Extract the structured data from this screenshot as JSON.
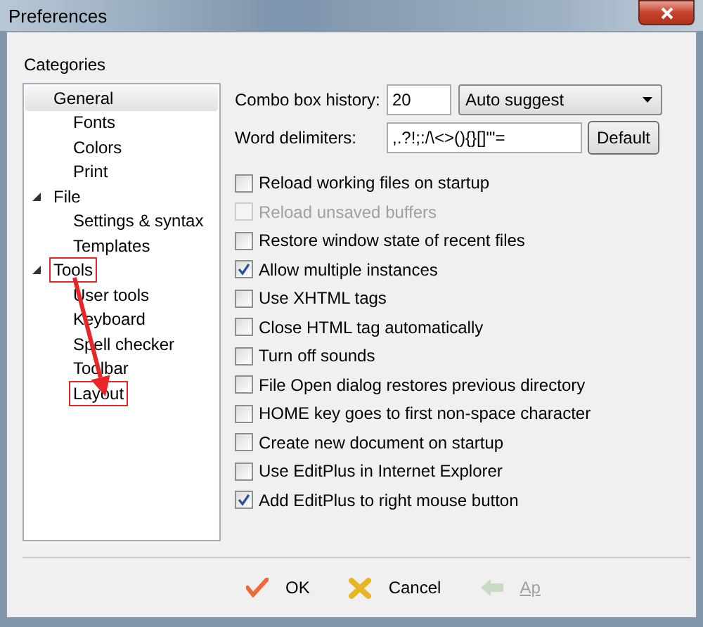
{
  "window": {
    "title": "Preferences"
  },
  "categories": {
    "label": "Categories",
    "items": [
      {
        "label": "General",
        "selected": true,
        "highlighted": false,
        "children": [
          {
            "label": "Fonts",
            "selected": false,
            "highlighted": false
          },
          {
            "label": "Colors",
            "selected": false,
            "highlighted": false
          },
          {
            "label": "Print",
            "selected": false,
            "highlighted": false
          }
        ]
      },
      {
        "label": "File",
        "selected": false,
        "highlighted": false,
        "expanded": true,
        "children": [
          {
            "label": "Settings & syntax",
            "selected": false,
            "highlighted": false
          },
          {
            "label": "Templates",
            "selected": false,
            "highlighted": false
          }
        ]
      },
      {
        "label": "Tools",
        "selected": false,
        "highlighted": true,
        "expanded": true,
        "children": [
          {
            "label": "User tools",
            "selected": false,
            "highlighted": false
          },
          {
            "label": "Keyboard",
            "selected": false,
            "highlighted": false
          },
          {
            "label": "Spell checker",
            "selected": false,
            "highlighted": false
          },
          {
            "label": "Toolbar",
            "selected": false,
            "highlighted": false
          },
          {
            "label": "Layout",
            "selected": false,
            "highlighted": true
          }
        ]
      }
    ]
  },
  "combo_box_history": {
    "label": "Combo box history:",
    "value": "20",
    "mode": "Auto suggest"
  },
  "word_delimiters": {
    "label": "Word delimiters:",
    "value": ",.?!;:/\\<>(){}[]\"'=",
    "button": "Default"
  },
  "options": [
    {
      "label": "Reload working files on startup",
      "checked": false,
      "disabled": false
    },
    {
      "label": "Reload unsaved buffers",
      "checked": false,
      "disabled": true
    },
    {
      "label": "Restore window state of recent files",
      "checked": false,
      "disabled": false
    },
    {
      "label": "Allow multiple instances",
      "checked": true,
      "disabled": false
    },
    {
      "label": "Use XHTML tags",
      "checked": false,
      "disabled": false
    },
    {
      "label": "Close HTML tag automatically",
      "checked": false,
      "disabled": false
    },
    {
      "label": "Turn off sounds",
      "checked": false,
      "disabled": false
    },
    {
      "label": "File Open dialog restores previous directory",
      "checked": false,
      "disabled": false
    },
    {
      "label": "HOME key goes to first non-space character",
      "checked": false,
      "disabled": false
    },
    {
      "label": "Create new document on startup",
      "checked": false,
      "disabled": false
    },
    {
      "label": "Use EditPlus in Internet Explorer",
      "checked": false,
      "disabled": false
    },
    {
      "label": "Add EditPlus to right mouse button",
      "checked": true,
      "disabled": false
    }
  ],
  "buttons": [
    {
      "kind": "ok",
      "label": "OK",
      "disabled": false
    },
    {
      "kind": "cancel",
      "label": "Cancel",
      "disabled": false
    },
    {
      "kind": "apply",
      "label": "Ap",
      "disabled": true
    }
  ]
}
